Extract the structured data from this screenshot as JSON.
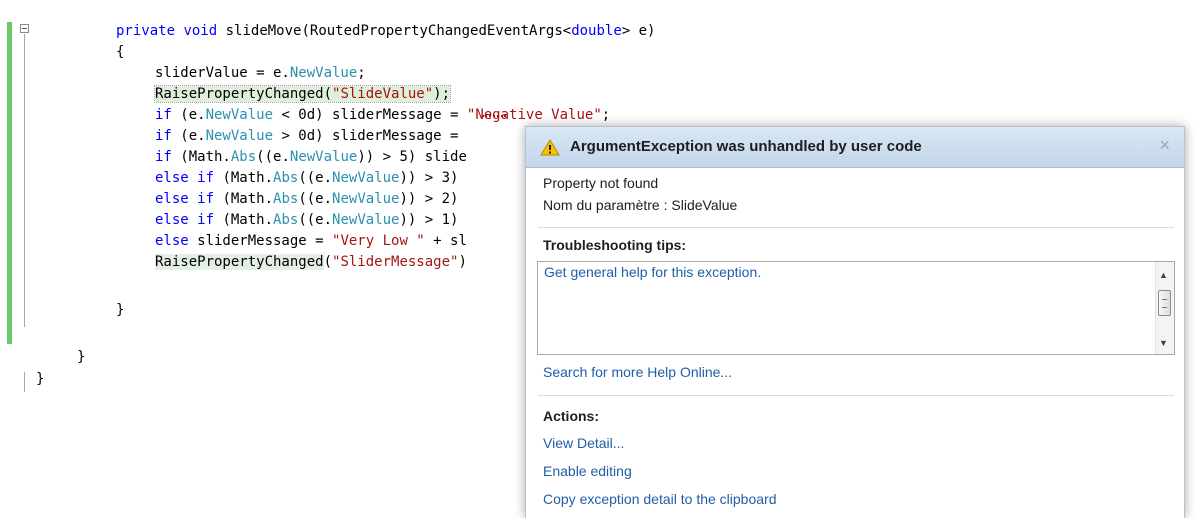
{
  "code": {
    "line1": {
      "kw1": "private",
      "kw2": "void",
      "name": "slideMove",
      "p1": "(RoutedPropertyChangedEventArgs<",
      "kw3": "double",
      "p2": "> e)"
    },
    "line2": "{",
    "line3": {
      "a": "sliderValue = e.",
      "b": "NewValue",
      "c": ";"
    },
    "line4": {
      "a": "RaisePropertyChanged(",
      "b": "\"SlideValue\"",
      "c": ");"
    },
    "line5": {
      "kw": "if",
      "a": " (e.",
      "b": "NewValue",
      "c": " < 0d) sliderMessage = ",
      "d": "\"Negative Value\"",
      "e": ";"
    },
    "line6": {
      "kw": "if",
      "a": " (e.",
      "b": "NewValue",
      "c": " > 0d) sliderMessage ="
    },
    "line7": {
      "kw": "if",
      "a": " (Math.",
      "b": "Abs",
      "c": "((e.",
      "d": "NewValue",
      "e": ")) > 5) slide"
    },
    "line8": {
      "kw1": "else",
      "kw2": "if",
      "a": " (Math.",
      "b": "Abs",
      "c": "((e.",
      "d": "NewValue",
      "e": ")) > 3)"
    },
    "line9": {
      "kw1": "else",
      "kw2": "if",
      "a": " (Math.",
      "b": "Abs",
      "c": "((e.",
      "d": "NewValue",
      "e": ")) > 2)"
    },
    "line10": {
      "kw1": "else",
      "kw2": "if",
      "a": " (Math.",
      "b": "Abs",
      "c": "((e.",
      "d": "NewValue",
      "e": ")) > 1)"
    },
    "line11": {
      "kw": "else",
      "a": " sliderMessage = ",
      "b": "\"Very Low \"",
      "c": " + sl"
    },
    "line12": {
      "a": "RaisePropertyChanged",
      "b": "(",
      "c": "\"SliderMessage\"",
      "d": ")"
    },
    "line13": "}",
    "line14": "}",
    "line15": "}"
  },
  "popup": {
    "title": "ArgumentException was unhandled by user code",
    "close": "×",
    "message_line1": "Property not found",
    "message_line2": "Nom du paramètre : SlideValue",
    "tips_heading": "Troubleshooting tips:",
    "tip_link": "Get general help for this exception.",
    "search_link": "Search for more Help Online...",
    "actions_heading": "Actions:",
    "actions": [
      "View Detail...",
      "Enable editing",
      "Copy exception detail to the clipboard"
    ]
  },
  "colors": {
    "keyword": "#0000ff",
    "type": "#2b91af",
    "string": "#a31515",
    "link": "#1f5ea8"
  },
  "icons": {
    "warning": "warning-icon",
    "collapse": "collapse-icon",
    "close": "close-icon"
  }
}
